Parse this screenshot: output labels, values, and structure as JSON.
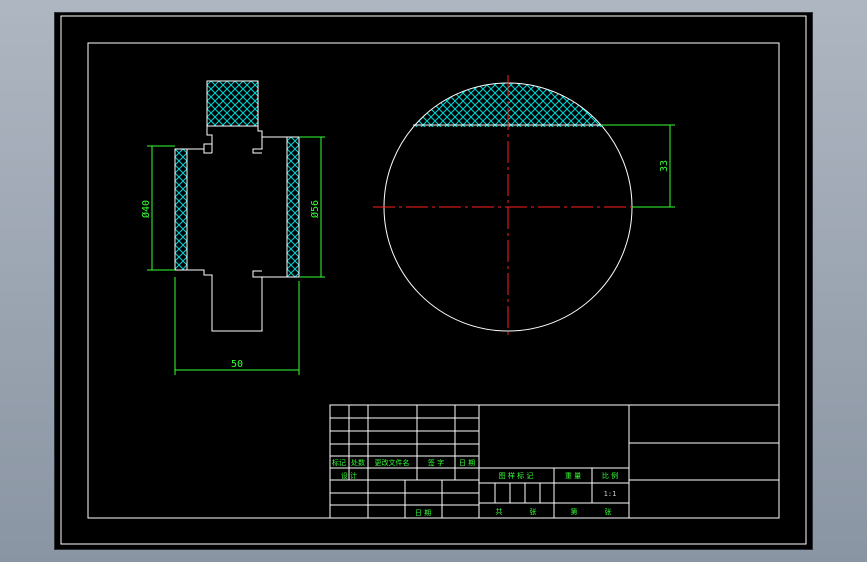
{
  "drawing": {
    "dimensions": {
      "dia_inner": "Ø40",
      "dia_outer": "Ø56",
      "length": "50",
      "flat_depth": "33"
    },
    "title_block": {
      "rev_labels": [
        "标记",
        "处数",
        "更改文件名",
        "签 字",
        "日 期"
      ],
      "design_label": "设 计",
      "date_label": "日 期",
      "stage_labels": [
        "图 样 标 记",
        "重 量",
        "比 例"
      ],
      "scale_value": "1:1",
      "sheet_labels": [
        "共",
        "张",
        "第",
        "张"
      ]
    }
  },
  "colors": {
    "background": "#000000",
    "outline": "#ffffff",
    "hatch": "#00d8d8",
    "dimension": "#33ff33",
    "centerline": "#ff2020"
  }
}
